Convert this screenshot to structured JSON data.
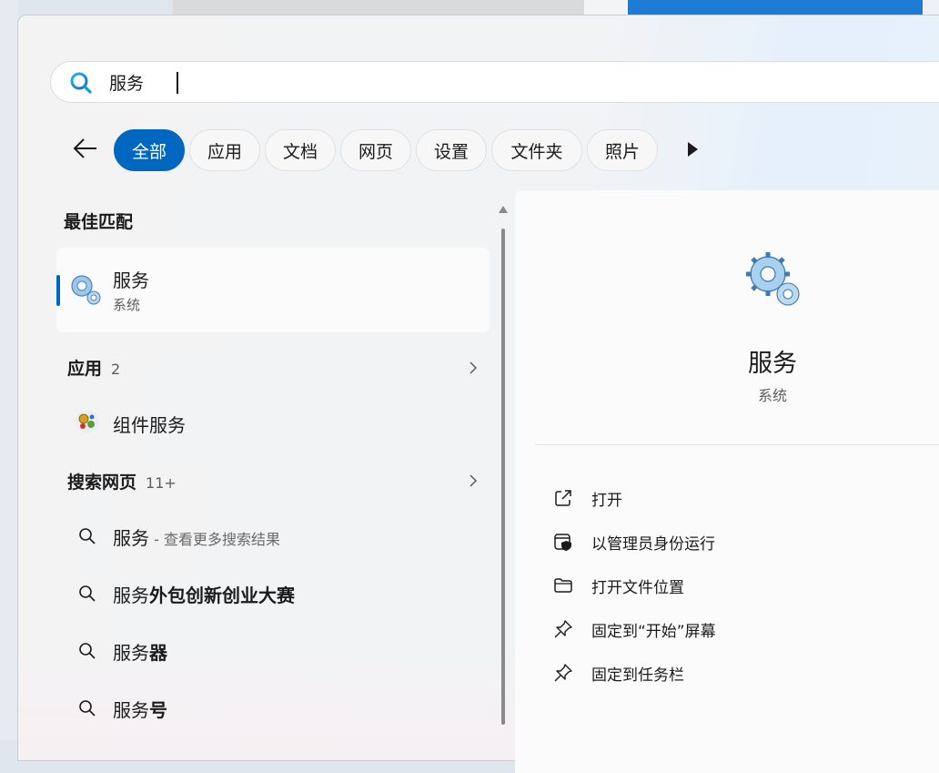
{
  "search": {
    "query": "服务"
  },
  "tabs": [
    "全部",
    "应用",
    "文档",
    "网页",
    "设置",
    "文件夹",
    "照片"
  ],
  "best_match": {
    "heading": "最佳匹配",
    "title": "服务",
    "subtitle": "系统"
  },
  "apps": {
    "heading": "应用",
    "count": "2",
    "items": [
      {
        "label": "组件服务"
      }
    ]
  },
  "web": {
    "heading": "搜索网页",
    "count": "11+",
    "items": [
      {
        "prefix": "服务",
        "bold": "",
        "hint": " - 查看更多搜索结果"
      },
      {
        "prefix": "服务",
        "bold": "外包创新创业大赛",
        "hint": ""
      },
      {
        "prefix": "服务",
        "bold": "器",
        "hint": ""
      },
      {
        "prefix": "服务",
        "bold": "号",
        "hint": ""
      }
    ]
  },
  "detail": {
    "title": "服务",
    "subtitle": "系统",
    "actions": [
      {
        "label": "打开",
        "icon": "open-external-icon"
      },
      {
        "label": "以管理员身份运行",
        "icon": "shield-run-icon"
      },
      {
        "label": "打开文件位置",
        "icon": "folder-icon"
      },
      {
        "label": "固定到“开始”屏幕",
        "icon": "pin-icon"
      },
      {
        "label": "固定到任务栏",
        "icon": "pin-icon"
      }
    ]
  },
  "colors": {
    "accent": "#0067c0",
    "panel": "#f3f3f4"
  }
}
